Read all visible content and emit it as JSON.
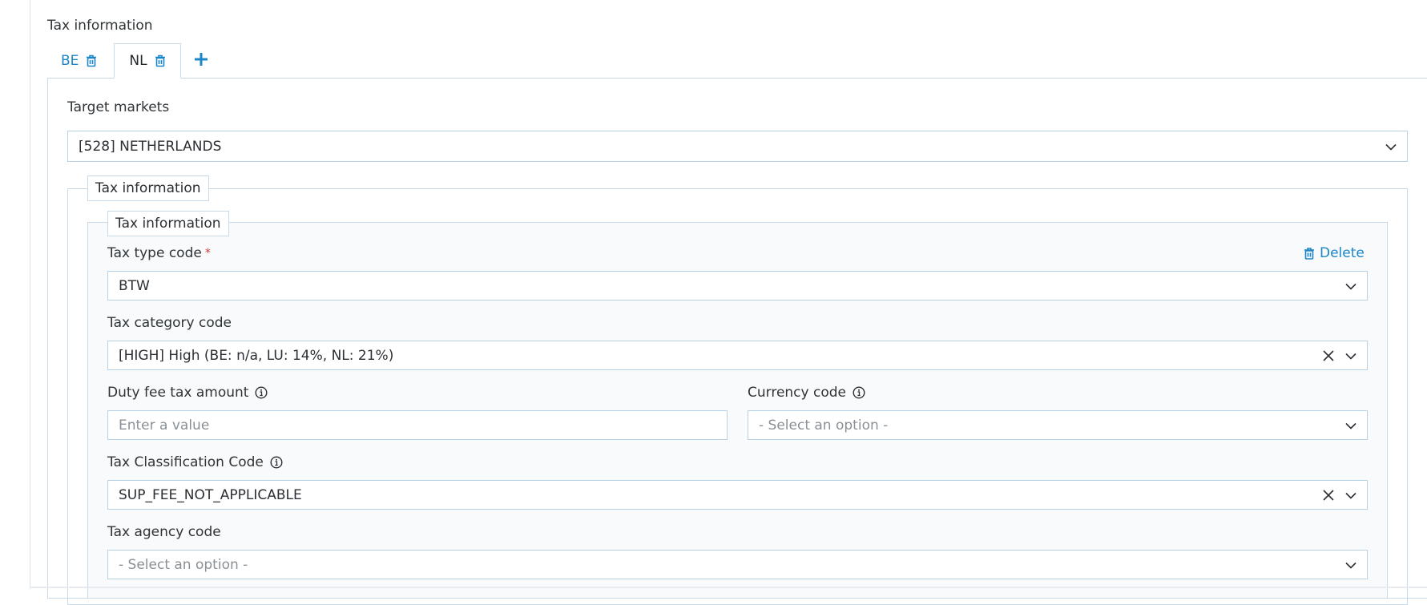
{
  "section": {
    "title": "Tax information"
  },
  "tabs": [
    {
      "label": "BE",
      "active": false
    },
    {
      "label": "NL",
      "active": true
    }
  ],
  "target_markets": {
    "label": "Target markets",
    "value": "[528] NETHERLANDS"
  },
  "outer_fieldset": {
    "legend": "Tax information"
  },
  "inner_fieldset": {
    "legend": "Tax information",
    "delete_label": "Delete",
    "tax_type_code": {
      "label": "Tax type code",
      "required_mark": "*",
      "value": "BTW"
    },
    "tax_category_code": {
      "label": "Tax category code",
      "value": "[HIGH] High (BE: n/a, LU: 14%, NL: 21%)"
    },
    "duty_fee_tax_amount": {
      "label": "Duty fee tax amount",
      "placeholder": "Enter a value"
    },
    "currency_code": {
      "label": "Currency code",
      "placeholder": "- Select an option -"
    },
    "tax_classification_code": {
      "label": "Tax Classification Code",
      "value": "SUP_FEE_NOT_APPLICABLE"
    },
    "tax_agency_code": {
      "label": "Tax agency code",
      "placeholder": "- Select an option -"
    }
  },
  "colors": {
    "accent": "#1c86c6",
    "border": "#b6d2e6",
    "required": "#d0393b",
    "inner_background": "#f8fafc"
  },
  "icons": {
    "tab_delete": "trash-icon",
    "tab_add": "plus-icon",
    "dropdown": "chevron-down-icon",
    "clear": "close-icon",
    "info": "info-icon"
  }
}
